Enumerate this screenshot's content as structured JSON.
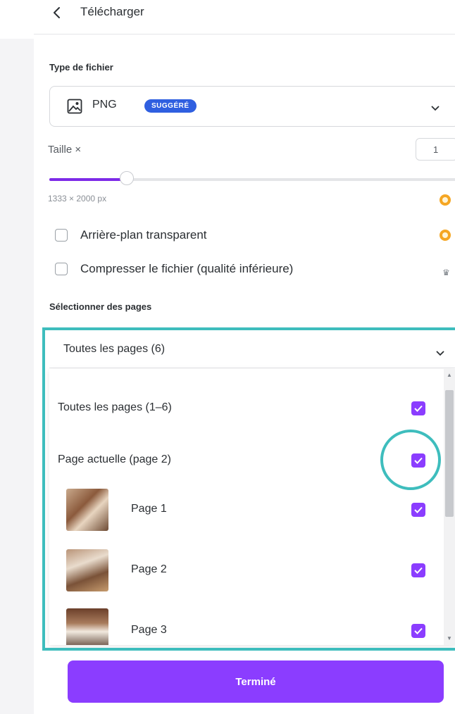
{
  "header": {
    "title": "Télécharger"
  },
  "file_type": {
    "section_label": "Type de fichier",
    "selected": "PNG",
    "badge": "SUGGÉRÉ",
    "icon": "image-icon"
  },
  "size": {
    "label": "Taille ×",
    "value": "1",
    "dimensions": "1333 × 2000 px",
    "slider_level_fraction": 0.19
  },
  "options": {
    "transparent_bg": {
      "label": "Arrière-plan transparent",
      "checked": false
    },
    "compress": {
      "label": "Compresser le fichier (qualité inférieure)",
      "checked": false
    }
  },
  "pages": {
    "section_label": "Sélectionner des pages",
    "selected": "Toutes les pages (6)",
    "all_pages": {
      "label": "Toutes les pages (1–6)",
      "checked": true
    },
    "current_page": {
      "label": "Page actuelle (page 2)",
      "checked": true
    },
    "items": [
      {
        "label": "Page 1",
        "checked": true
      },
      {
        "label": "Page 2",
        "checked": true
      },
      {
        "label": "Page 3",
        "checked": true
      }
    ]
  },
  "done_button": {
    "label": "Terminé"
  },
  "colors": {
    "accent": "#8b3dff",
    "badge": "#2f5fe0",
    "highlight": "#3ebdbd",
    "pro_crown": "#f5a623"
  }
}
